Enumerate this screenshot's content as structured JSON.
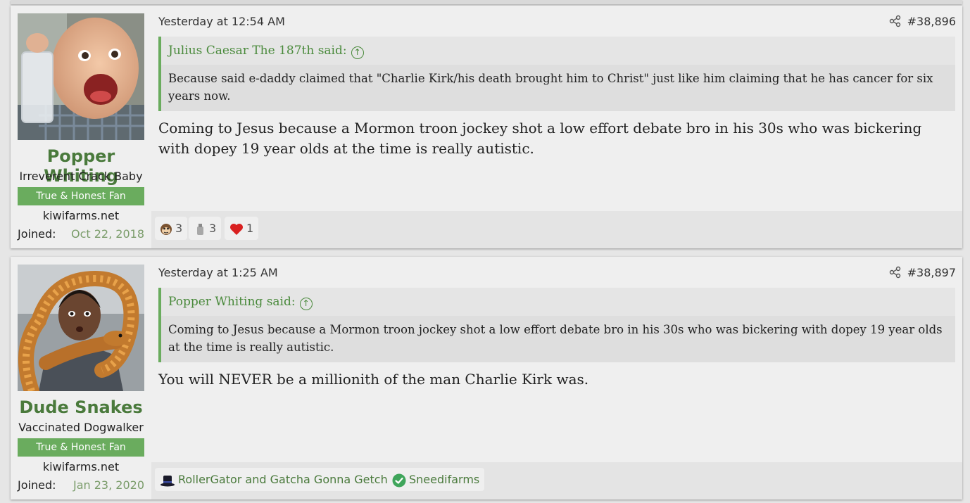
{
  "posts": [
    {
      "user": {
        "name": "Popper Whiting",
        "title": "Irreverent Crack Baby",
        "banner": "True & Honest Fan",
        "site": "kiwifarms.net",
        "joined_label": "Joined:",
        "joined_date": "Oct 22, 2018",
        "avatar_icon": "laughing-baby-avatar"
      },
      "date": "Yesterday at 12:54 AM",
      "post_number": "#38,896",
      "quote": {
        "author": "Julius Caesar The 187th said:",
        "text": "Because said e-daddy claimed that \"Charlie Kirk/his death brought him to Christ\" just like him claiming that he has cancer for six years now."
      },
      "message": "Coming to Jesus because a Mormon troon jockey shot a low effort debate bro in his 30s who was bickering with dopey 19 year olds at the time is really autistic.",
      "reactions": [
        {
          "icon": "monkey-face-icon",
          "count": "3"
        },
        {
          "icon": "gray-bottle-icon",
          "count": "3"
        },
        {
          "icon": "heart-icon",
          "count": "1"
        }
      ]
    },
    {
      "user": {
        "name": "Dude Snakes",
        "title": "Vaccinated Dogwalker",
        "banner": "True & Honest Fan",
        "site": "kiwifarms.net",
        "joined_label": "Joined:",
        "joined_date": "Jan 23, 2020",
        "avatar_icon": "man-with-snake-avatar"
      },
      "date": "Yesterday at 1:25 AM",
      "post_number": "#38,897",
      "quote": {
        "author": "Popper Whiting said:",
        "text": "Coming to Jesus because a Mormon troon jockey shot a low effort debate bro in his 30s who was bickering with dopey 19 year olds at the time is really autistic."
      },
      "message": "You will NEVER be a millionith of the man Charlie Kirk was.",
      "reactions": [
        {
          "icon": "top-hat-icon",
          "label": "RollerGator and Gatcha Gonna Getcha"
        },
        {
          "icon": "check-badge-icon",
          "label": "Sneedifarms"
        }
      ]
    }
  ],
  "colors": {
    "username": "#4a7a3c",
    "banner": "#6aac5e",
    "quote_border": "#6aac5e",
    "joined_date": "#7a9c6a"
  }
}
